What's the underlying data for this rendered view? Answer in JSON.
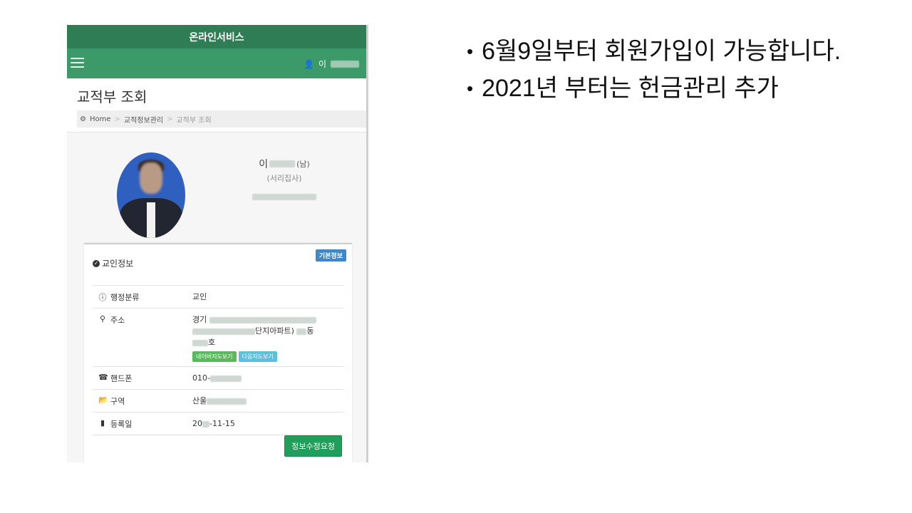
{
  "app": {
    "title": "온라인서비스"
  },
  "navbar": {
    "user_prefix": "이"
  },
  "page": {
    "title": "교적부 조회",
    "breadcrumb": [
      "Home",
      "교적정보관리",
      "교적부 조회"
    ]
  },
  "profile": {
    "name_prefix": "이",
    "gender": "(남)",
    "role": "(서리집사)"
  },
  "card": {
    "title": "교인정보",
    "badge": "기본정보",
    "rows": [
      {
        "label": "행정분류",
        "value": "교인",
        "icon": "info-icon"
      },
      {
        "label": "주소",
        "value_prefix": "경기",
        "value_mid": "단지아파트)",
        "value_dong": "동",
        "value_ho": "호",
        "icon": "map-marker-icon"
      },
      {
        "label": "핸드폰",
        "value": "010-",
        "icon": "phone-icon"
      },
      {
        "label": "구역",
        "value": "산울",
        "icon": "folder-open-icon"
      },
      {
        "label": "등록일",
        "value_prefix": "20",
        "value_suffix": "-11-15",
        "icon": "bookmark-icon"
      }
    ],
    "map_buttons": {
      "naver": "네이버지도보기",
      "daum": "다음지도보기"
    },
    "edit_button": "정보수정요청"
  },
  "slide": {
    "bullets": [
      "6월9일부터 회원가입이 가능합니다.",
      "2021년 부터는 헌금관리 추가"
    ]
  }
}
